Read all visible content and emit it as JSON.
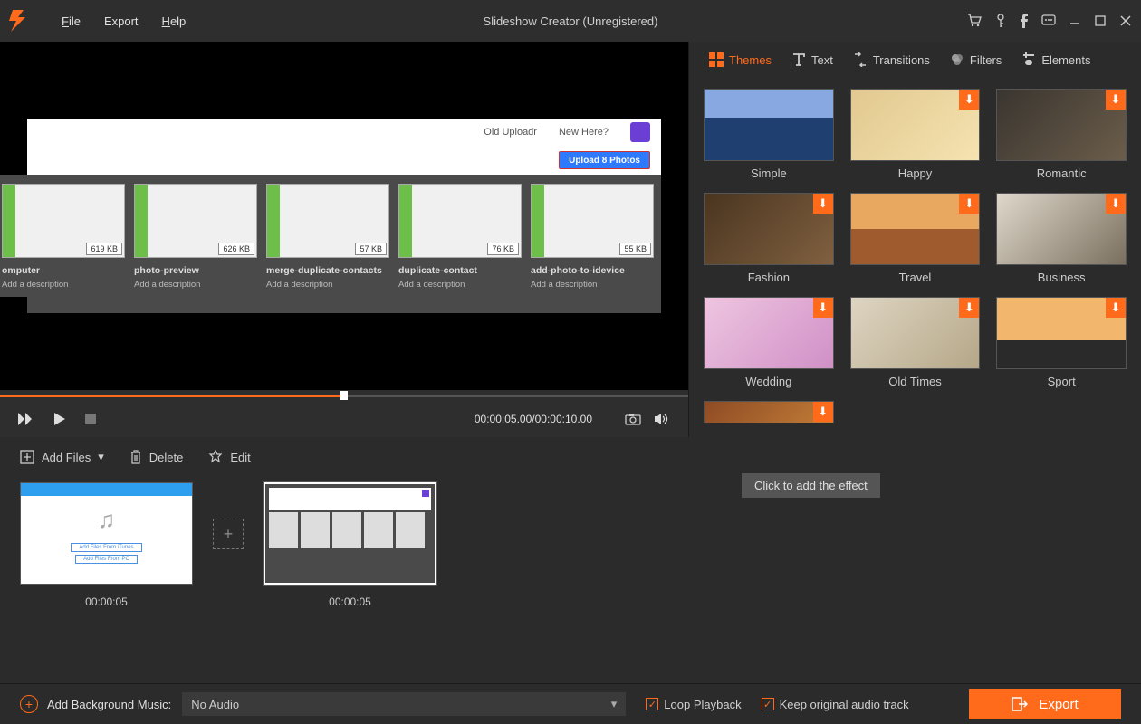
{
  "app": {
    "title": "Slideshow Creator (Unregistered)",
    "menu": {
      "file": "File",
      "export": "Export",
      "help": "Help"
    }
  },
  "preview": {
    "slide": {
      "header": {
        "old": "Old Uploadr",
        "newhere": "New Here?"
      },
      "upload_btn": "Upload 8 Photos",
      "thumbs": [
        {
          "size": "619 KB",
          "label": "omputer",
          "desc": "Add a description"
        },
        {
          "size": "626 KB",
          "label": "photo-preview",
          "desc": "Add a description"
        },
        {
          "size": "57 KB",
          "label": "merge-duplicate-contacts",
          "desc": "Add a description"
        },
        {
          "size": "76 KB",
          "label": "duplicate-contact",
          "desc": "Add a description"
        },
        {
          "size": "55 KB",
          "label": "add-photo-to-idevice",
          "desc": "Add a description"
        }
      ]
    },
    "time": "00:00:05.00/00:00:10.00"
  },
  "tabs": {
    "themes": "Themes",
    "text": "Text",
    "transitions": "Transitions",
    "filters": "Filters",
    "elements": "Elements"
  },
  "themes": [
    {
      "key": "simple",
      "label": "Simple",
      "dl": false
    },
    {
      "key": "happy",
      "label": "Happy",
      "dl": true
    },
    {
      "key": "romantic",
      "label": "Romantic",
      "dl": true
    },
    {
      "key": "fashion",
      "label": "Fashion",
      "dl": true
    },
    {
      "key": "travel",
      "label": "Travel",
      "dl": true
    },
    {
      "key": "business",
      "label": "Business",
      "dl": true
    },
    {
      "key": "wedding",
      "label": "Wedding",
      "dl": true
    },
    {
      "key": "oldtimes",
      "label": "Old Times",
      "dl": true
    },
    {
      "key": "sport",
      "label": "Sport",
      "dl": true
    },
    {
      "key": "extra",
      "label": "",
      "dl": true
    }
  ],
  "timeline": {
    "add_files": "Add Files",
    "delete": "Delete",
    "edit": "Edit",
    "clip1_time": "00:00:05",
    "clip2_time": "00:00:05",
    "tooltip": "Click to add the effect"
  },
  "bottom": {
    "add_music": "Add Background Music:",
    "audio": "No Audio",
    "loop": "Loop Playback",
    "keep": "Keep original audio track",
    "export": "Export"
  }
}
